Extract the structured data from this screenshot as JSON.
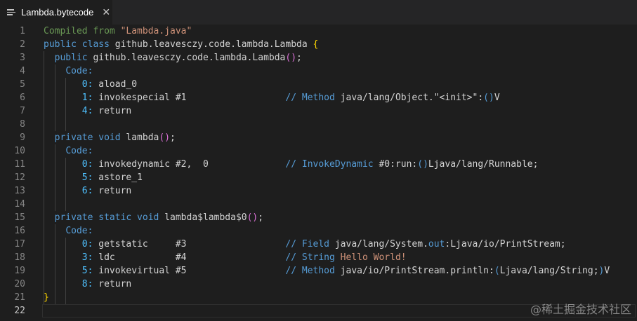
{
  "tab": {
    "title": "Lambda.bytecode",
    "close": "✕"
  },
  "lines": [
    {
      "n": "1",
      "t": [
        [
          "c-com",
          "Compiled from "
        ],
        [
          "c-str",
          "\"Lambda.java\""
        ]
      ]
    },
    {
      "n": "2",
      "t": [
        [
          "c-kw",
          "public class "
        ],
        [
          "c-tx",
          "github.leavesczy.code.lambda.Lambda "
        ],
        [
          "c-p1",
          "{"
        ]
      ]
    },
    {
      "n": "3",
      "t": [
        [
          "c-tx",
          "  "
        ],
        [
          "c-kw",
          "public "
        ],
        [
          "c-tx",
          "github.leavesczy.code.lambda.Lambda"
        ],
        [
          "c-p2",
          "()"
        ],
        [
          "c-tx",
          ";"
        ]
      ]
    },
    {
      "n": "4",
      "t": [
        [
          "c-tx",
          "    "
        ],
        [
          "c-kw",
          "Code:"
        ]
      ]
    },
    {
      "n": "5",
      "t": [
        [
          "c-tx",
          "       "
        ],
        [
          "c-lbl",
          "0: "
        ],
        [
          "c-tx",
          "aload_0"
        ]
      ]
    },
    {
      "n": "6",
      "t": [
        [
          "c-tx",
          "       "
        ],
        [
          "c-lbl",
          "1: "
        ],
        [
          "c-tx",
          "invokespecial #1                  "
        ],
        [
          "c-kw",
          "// Method "
        ],
        [
          "c-tx",
          "java/lang/Object.\"<init>\":"
        ],
        [
          "c-kw",
          "()"
        ],
        [
          "c-tx",
          "V"
        ]
      ]
    },
    {
      "n": "7",
      "t": [
        [
          "c-tx",
          "       "
        ],
        [
          "c-lbl",
          "4: "
        ],
        [
          "c-tx",
          "return"
        ]
      ]
    },
    {
      "n": "8",
      "t": []
    },
    {
      "n": "9",
      "t": [
        [
          "c-tx",
          "  "
        ],
        [
          "c-kw",
          "private void "
        ],
        [
          "c-tx",
          "lambda"
        ],
        [
          "c-p2",
          "()"
        ],
        [
          "c-tx",
          ";"
        ]
      ]
    },
    {
      "n": "10",
      "t": [
        [
          "c-tx",
          "    "
        ],
        [
          "c-kw",
          "Code:"
        ]
      ]
    },
    {
      "n": "11",
      "t": [
        [
          "c-tx",
          "       "
        ],
        [
          "c-lbl",
          "0: "
        ],
        [
          "c-tx",
          "invokedynamic #2,  0              "
        ],
        [
          "c-kw",
          "// InvokeDynamic "
        ],
        [
          "c-tx",
          "#0:run:"
        ],
        [
          "c-kw",
          "()"
        ],
        [
          "c-tx",
          "Ljava/lang/Runnable;"
        ]
      ]
    },
    {
      "n": "12",
      "t": [
        [
          "c-tx",
          "       "
        ],
        [
          "c-lbl",
          "5: "
        ],
        [
          "c-tx",
          "astore_1"
        ]
      ]
    },
    {
      "n": "13",
      "t": [
        [
          "c-tx",
          "       "
        ],
        [
          "c-lbl",
          "6: "
        ],
        [
          "c-tx",
          "return"
        ]
      ]
    },
    {
      "n": "14",
      "t": []
    },
    {
      "n": "15",
      "t": [
        [
          "c-tx",
          "  "
        ],
        [
          "c-kw",
          "private static void "
        ],
        [
          "c-tx",
          "lambda$lambda$0"
        ],
        [
          "c-p2",
          "()"
        ],
        [
          "c-tx",
          ";"
        ]
      ]
    },
    {
      "n": "16",
      "t": [
        [
          "c-tx",
          "    "
        ],
        [
          "c-kw",
          "Code:"
        ]
      ]
    },
    {
      "n": "17",
      "t": [
        [
          "c-tx",
          "       "
        ],
        [
          "c-lbl",
          "0: "
        ],
        [
          "c-tx",
          "getstatic     #3                  "
        ],
        [
          "c-kw",
          "// Field "
        ],
        [
          "c-tx",
          "java/lang/System."
        ],
        [
          "c-kw",
          "out"
        ],
        [
          "c-tx",
          ":Ljava/io/PrintStream;"
        ]
      ]
    },
    {
      "n": "18",
      "t": [
        [
          "c-tx",
          "       "
        ],
        [
          "c-lbl",
          "3: "
        ],
        [
          "c-tx",
          "ldc           #4                  "
        ],
        [
          "c-kw",
          "// String "
        ],
        [
          "c-str",
          "Hello World!"
        ]
      ]
    },
    {
      "n": "19",
      "t": [
        [
          "c-tx",
          "       "
        ],
        [
          "c-lbl",
          "5: "
        ],
        [
          "c-tx",
          "invokevirtual #5                  "
        ],
        [
          "c-kw",
          "// Method "
        ],
        [
          "c-tx",
          "java/io/PrintStream.println:"
        ],
        [
          "c-kw",
          "("
        ],
        [
          "c-tx",
          "Ljava/lang/String;"
        ],
        [
          "c-kw",
          ")"
        ],
        [
          "c-tx",
          "V"
        ]
      ]
    },
    {
      "n": "20",
      "t": [
        [
          "c-tx",
          "       "
        ],
        [
          "c-lbl",
          "8: "
        ],
        [
          "c-tx",
          "return"
        ]
      ]
    },
    {
      "n": "21",
      "t": [
        [
          "c-p1",
          "}"
        ]
      ]
    },
    {
      "n": "22",
      "t": []
    }
  ],
  "watermark": "@稀土掘金技术社区"
}
